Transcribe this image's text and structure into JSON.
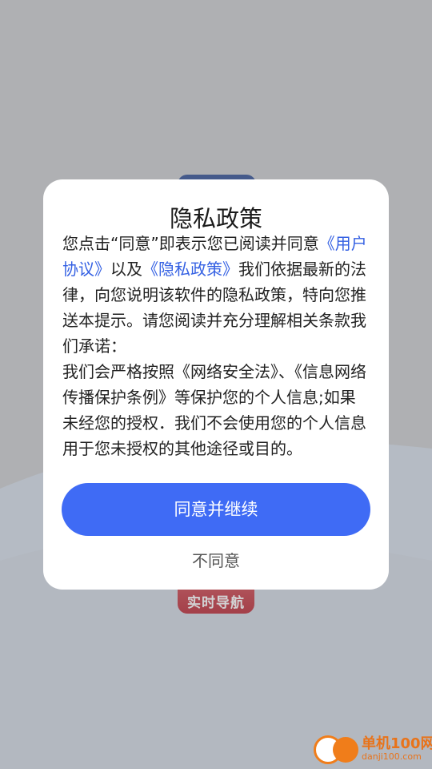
{
  "app": {
    "icon_label": "实时导航"
  },
  "dialog": {
    "title": "隐私政策",
    "body": {
      "part1": "您点击“同意”即表示您已阅读并同意",
      "link_user_agreement": "《用户协议》",
      "part2": "以及",
      "link_privacy_policy": "《隐私政策》",
      "part3": "我们依据最新的法律，向您说明该软件的隐私政策，特向您推送本提示。请您阅读并充分理解相关条款我们承诺：",
      "part4": "我们会严格按照《网络安全法》、《信息网络传播保护条例》等保护您的个人信息;如果未经您的授权．我们不会使用您的个人信息用于您未授权的其他途径或目的。"
    },
    "agree_label": "同意并继续",
    "disagree_label": "不同意"
  },
  "watermark": {
    "name_cn": "单机100网",
    "domain": "danji100.com"
  },
  "colors": {
    "accent": "#3f6bf5",
    "link": "#3561e3",
    "overlay": "#7f8184"
  }
}
